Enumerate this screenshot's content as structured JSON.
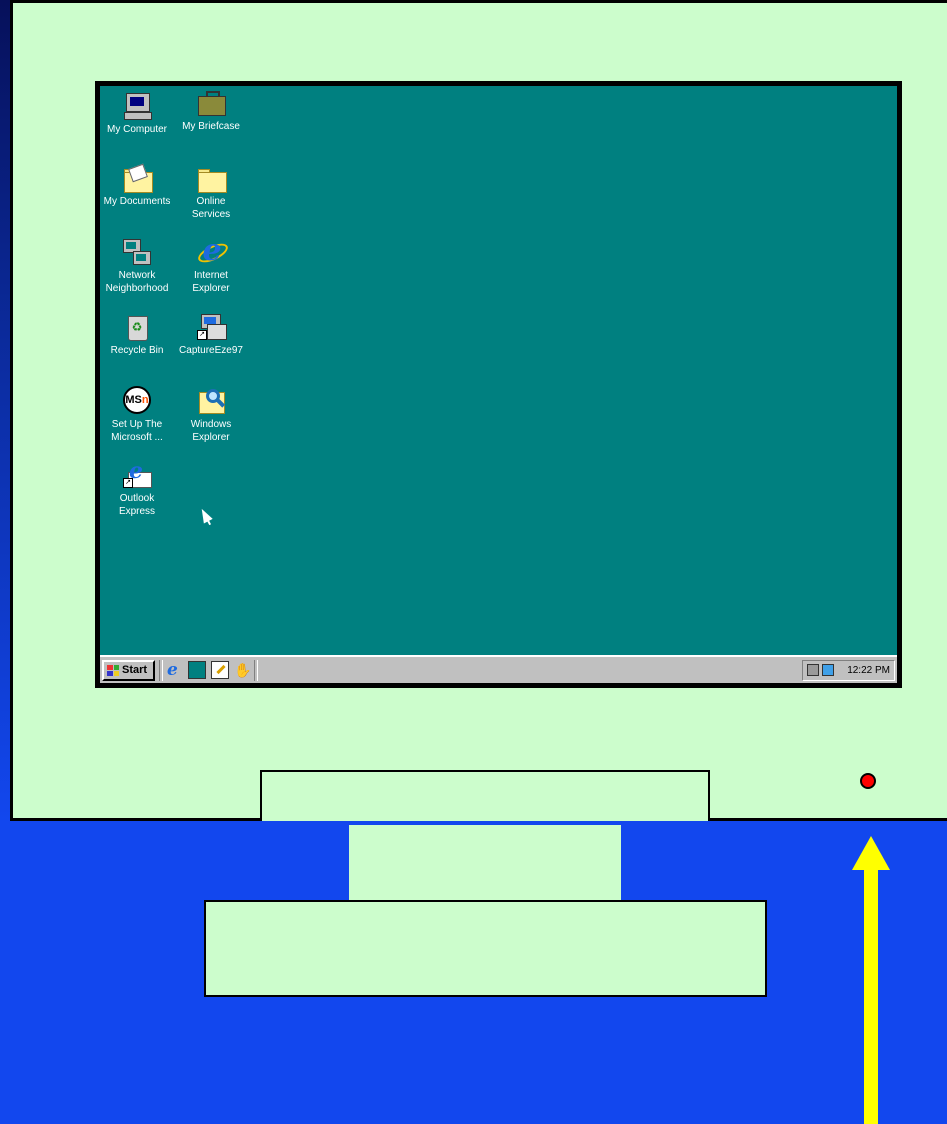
{
  "desktop_icons": [
    {
      "name": "my-computer-icon",
      "label": "My Computer"
    },
    {
      "name": "my-briefcase-icon",
      "label": "My Briefcase"
    },
    {
      "name": "my-documents-icon",
      "label": "My Documents"
    },
    {
      "name": "online-services-icon",
      "label": "Online\nServices"
    },
    {
      "name": "network-neighborhood-icon",
      "label": "Network\nNeighborhood"
    },
    {
      "name": "internet-explorer-icon",
      "label": "Internet\nExplorer"
    },
    {
      "name": "recycle-bin-icon",
      "label": "Recycle Bin"
    },
    {
      "name": "captureeze97-icon",
      "label": "CaptureEze97"
    },
    {
      "name": "msn-setup-icon",
      "label": "Set Up The\nMicrosoft ..."
    },
    {
      "name": "windows-explorer-icon",
      "label": "Windows\nExplorer"
    },
    {
      "name": "outlook-express-icon",
      "label": "Outlook\nExpress"
    }
  ],
  "taskbar": {
    "start_label": "Start",
    "quick_launch": [
      "internet-explorer-icon",
      "show-desktop-icon",
      "edit-icon",
      "channels-icon"
    ],
    "tray_icons": [
      "scheduler-icon",
      "network-icon"
    ],
    "clock": "12:22 PM"
  },
  "colors": {
    "background": "#1247ee",
    "monitor_body": "#ccfdcc",
    "desktop": "#008080",
    "power_led": "#ff0000",
    "arrow": "#ffff00"
  }
}
